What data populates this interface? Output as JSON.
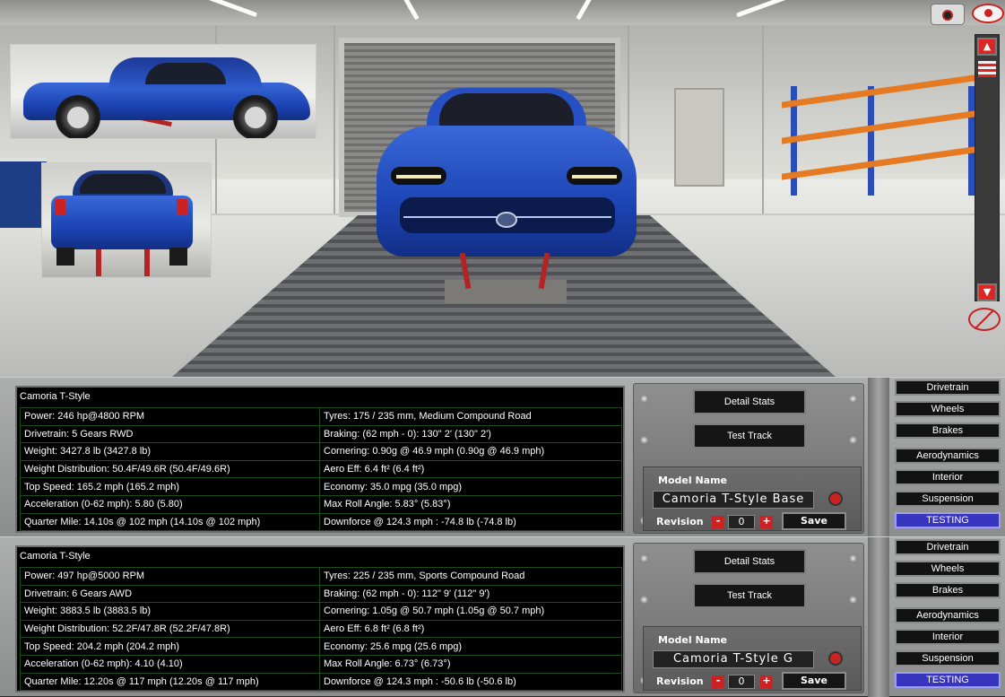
{
  "colors": {
    "accent_yellow": "#f2dc46",
    "active_tab": "#3734c0",
    "car_blue": "#1c44b4"
  },
  "icons": {
    "camera": "camera-icon",
    "visibility": "eye-icon",
    "hide": "hide-eye-icon",
    "scroll_up": "arrow-up-icon",
    "scroll_down": "arrow-down-icon"
  },
  "top_cars": [
    {
      "title": "Camoria  T-Style",
      "rows": [
        [
          "Power: 246 hp@4800 RPM",
          "Tyres: 175 / 235 mm, Medium Compound Road"
        ],
        [
          "Drivetrain: 5 Gears RWD",
          "Braking: (62 mph - 0): 130\" 2' (130\" 2')"
        ],
        [
          "Weight: 3427.8 lb (3427.8 lb)",
          "Cornering: 0.90g @ 46.9 mph (0.90g @ 46.9 mph)"
        ],
        [
          "Weight Distribution: 50.4F/49.6R (50.4F/49.6R)",
          "Aero Eff: 6.4 ft² (6.4 ft²)"
        ],
        [
          "Top Speed: 165.2 mph (165.2 mph)",
          "Economy: 35.0 mpg (35.0 mpg)"
        ],
        [
          "Acceleration (0-62 mph): 5.80 (5.80)",
          "Max Roll Angle: 5.83° (5.83°)"
        ],
        [
          "Quarter Mile: 14.10s @ 102 mph (14.10s @ 102 mph)",
          "Downforce @ 124.3 mph : -74.8 lb (-74.8 lb)"
        ]
      ],
      "rows_hl": [
        [
          "Power: 246 hp@4800 RPM",
          "Tyres: 175 / 235 mm, Medium Compound Road"
        ],
        [
          "Drivetrain: 5 Gears RWD",
          "Braking: (62 mph - 0): 130\" 2'"
        ],
        [
          "Weight: 3427.8 lb",
          "Cornering: 0.90g @ 46.9 mph"
        ],
        [
          "Weight Distribution: 50.4F/49.6R",
          "Aero Eff: 6.4 ft²"
        ],
        [
          "Top Speed: 165.2 mph",
          "Economy: 35.0 mpg"
        ],
        [
          "Acceleration (0-62 mph): 5.80",
          "Max Roll Angle: 5.83°"
        ],
        [
          "Quarter Mile: 14.10s @ 102 mph",
          "Downforce @ 124.3 mph : -74.8 lb"
        ]
      ]
    },
    {
      "title": "Camoria  T-Style",
      "rows": [
        [
          "Power: 497 hp@5000 RPM",
          "Tyres: 225 / 235 mm, Sports Compound Road"
        ],
        [
          "Drivetrain: 6 Gears AWD",
          "Braking: (62 mph - 0): 112\" 9' (112\" 9')"
        ],
        [
          "Weight: 3883.5 lb (3883.5 lb)",
          "Cornering: 1.05g @ 50.7 mph (1.05g @ 50.7 mph)"
        ],
        [
          "Weight Distribution: 52.2F/47.8R (52.2F/47.8R)",
          "Aero Eff: 6.8 ft² (6.8 ft²)"
        ],
        [
          "Top Speed: 204.2 mph (204.2 mph)",
          "Economy: 25.6 mpg (25.6 mpg)"
        ],
        [
          "Acceleration (0-62 mph): 4.10 (4.10)",
          "Max Roll Angle: 6.73° (6.73°)"
        ],
        [
          "Quarter Mile: 12.20s @ 117 mph (12.20s @ 117 mph)",
          "Downforce @ 124.3 mph : -50.6 lb (-50.6 lb)"
        ]
      ]
    }
  ],
  "panels": [
    {
      "detail_stats": "Detail Stats",
      "test_track": "Test Track",
      "model_name_label": "Model Name",
      "model_name_value": "Camoria  T-Style Base",
      "revision_label": "Revision",
      "revision_value": "0",
      "minus": "-",
      "plus": "+",
      "save": "Save"
    },
    {
      "detail_stats": "Detail Stats",
      "test_track": "Test Track",
      "model_name_label": "Model Name",
      "model_name_value": "Camoria  T-Style G",
      "revision_label": "Revision",
      "revision_value": "0",
      "minus": "-",
      "plus": "+",
      "save": "Save"
    }
  ],
  "nav": [
    "Drivetrain",
    "Wheels",
    "Brakes",
    "Aerodynamics",
    "Interior",
    "Suspension",
    "TESTING"
  ],
  "nav_active": "TESTING"
}
